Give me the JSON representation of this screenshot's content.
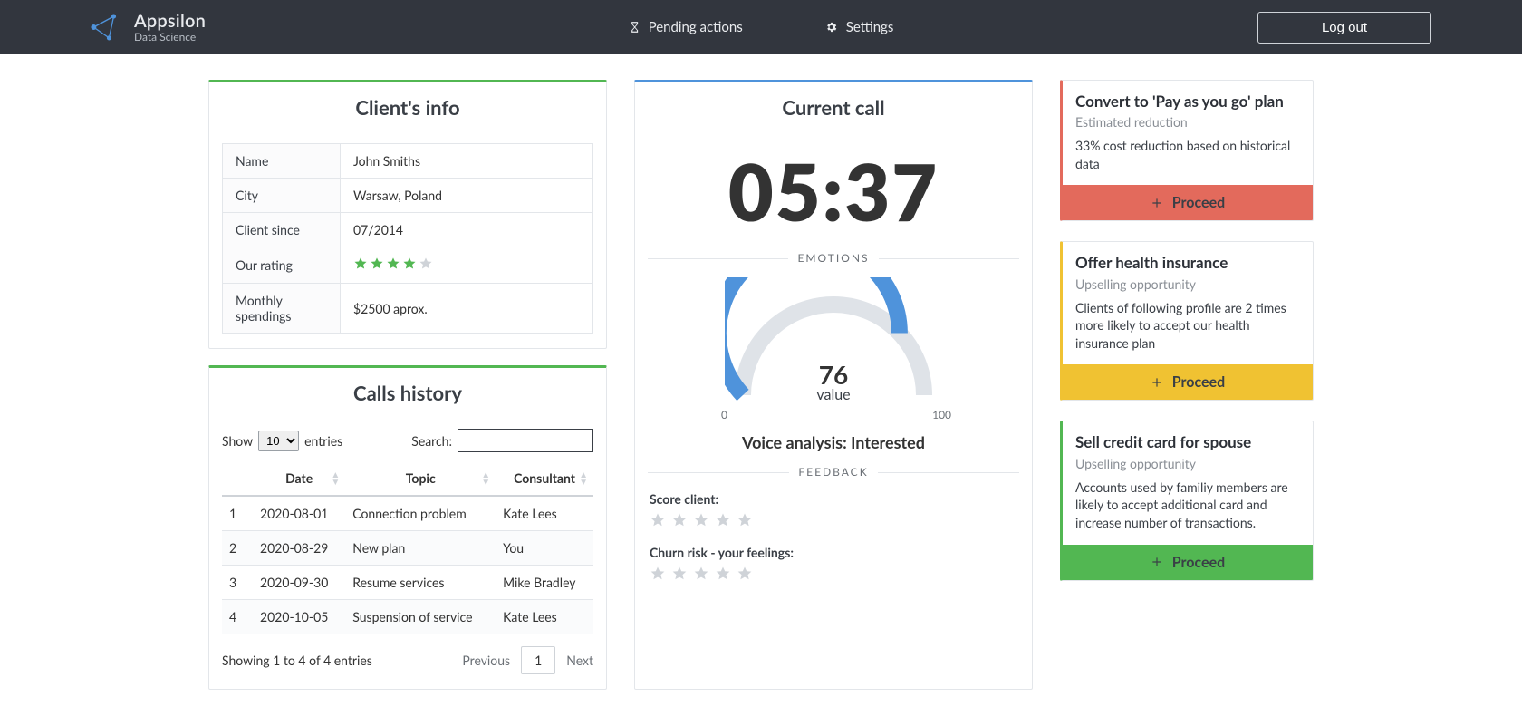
{
  "header": {
    "brand_name": "Appsilon",
    "brand_sub": "Data Science",
    "nav": {
      "pending": "Pending actions",
      "settings": "Settings"
    },
    "logout": "Log out"
  },
  "client_info": {
    "title": "Client's info",
    "rows": {
      "name_label": "Name",
      "name": "John Smiths",
      "city_label": "City",
      "city": "Warsaw, Poland",
      "since_label": "Client since",
      "since": "07/2014",
      "rating_label": "Our rating",
      "rating": 4,
      "spend_label": "Monthly spendings",
      "spend": "$2500 aprox."
    }
  },
  "calls": {
    "title": "Calls history",
    "show_pre": "Show",
    "show_post": "entries",
    "page_size": "10",
    "search_label": "Search:",
    "search_value": "",
    "columns": {
      "idx": "",
      "date": "Date",
      "topic": "Topic",
      "consultant": "Consultant"
    },
    "rows": [
      {
        "idx": "1",
        "date": "2020-08-01",
        "topic": "Connection problem",
        "consultant": "Kate Lees"
      },
      {
        "idx": "2",
        "date": "2020-08-29",
        "topic": "New plan",
        "consultant": "You"
      },
      {
        "idx": "3",
        "date": "2020-09-30",
        "topic": "Resume services",
        "consultant": "Mike Bradley"
      },
      {
        "idx": "4",
        "date": "2020-10-05",
        "topic": "Suspension of service",
        "consultant": "Kate Lees"
      }
    ],
    "summary": "Showing 1 to 4 of 4 entries",
    "prev": "Previous",
    "page": "1",
    "next": "Next"
  },
  "call": {
    "title": "Current call",
    "timer": "05:37",
    "emotions_label": "EMOTIONS",
    "gauge": {
      "value": 76,
      "label": "value",
      "min": "0",
      "max": "100"
    },
    "voice_prefix": "Voice analysis: ",
    "voice_value": "Interested",
    "feedback_label": "FEEDBACK",
    "score_label": "Score client:",
    "churn_label": "Churn risk - your feelings:"
  },
  "actions": [
    {
      "color": "red",
      "title": "Convert to 'Pay as you go' plan",
      "sub": "Estimated reduction",
      "desc": "33% cost reduction based on historical data",
      "cta": "Proceed"
    },
    {
      "color": "yellow",
      "title": "Offer health insurance",
      "sub": "Upselling opportunity",
      "desc": "Clients of following profile are 2 times more likely to accept our health insurance plan",
      "cta": "Proceed"
    },
    {
      "color": "green",
      "title": "Sell credit card for spouse",
      "sub": "Upselling opportunity",
      "desc": "Accounts used by familiy members are likely to accept additional card and increase number of transactions.",
      "cta": "Proceed"
    }
  ],
  "chart_data": {
    "type": "gauge",
    "value": 76,
    "min": 0,
    "max": 100,
    "title": "EMOTIONS",
    "value_label": "value",
    "annotation": "Voice analysis: Interested"
  }
}
